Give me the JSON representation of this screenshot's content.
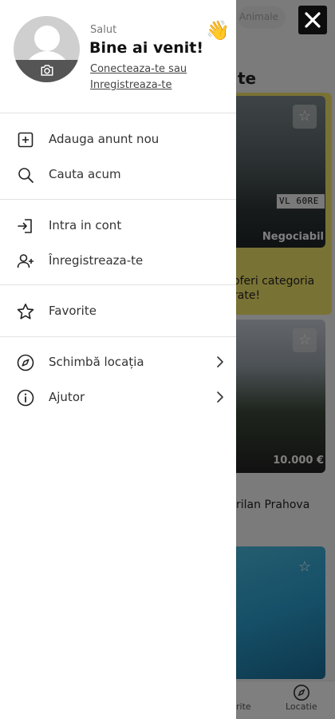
{
  "background": {
    "top_chip": "Animale",
    "section_heading": "te",
    "card1": {
      "plate": "VL 60RE",
      "badge": "Negociabil",
      "text_line1": "oferi categoria",
      "text_line2": "rate!"
    },
    "card2": {
      "price": "10.000 €",
      "text": "rilan Prahova"
    },
    "bottom_tabs": {
      "favorites_partial": "rite",
      "location": "Locatie"
    }
  },
  "drawer": {
    "greeting_small": "Salut",
    "greeting_big": "Bine ai venit!",
    "wave_emoji": "👋",
    "auth_line1": "Conecteaza-te sau",
    "auth_line2": "Inregistreaza-te",
    "menu": {
      "add_ad": "Adauga anunt nou",
      "search": "Cauta acum",
      "login": "Intra in cont",
      "register": "Înregistreaza-te",
      "favorites": "Favorite",
      "change_location": "Schimbă locația",
      "help": "Ajutor"
    }
  },
  "colors": {
    "accent_yellow": "#f3e56a",
    "close_button": "#0d0d0d",
    "overlay": "rgba(0,0,0,0.5)"
  },
  "icons": {
    "close": "close-icon",
    "camera": "camera-icon",
    "add": "plus-square-icon",
    "search": "search-icon",
    "login": "login-icon",
    "register": "user-plus-icon",
    "favorites": "star-icon",
    "location": "compass-icon",
    "help": "info-icon",
    "chevron": "chevron-right-icon"
  }
}
